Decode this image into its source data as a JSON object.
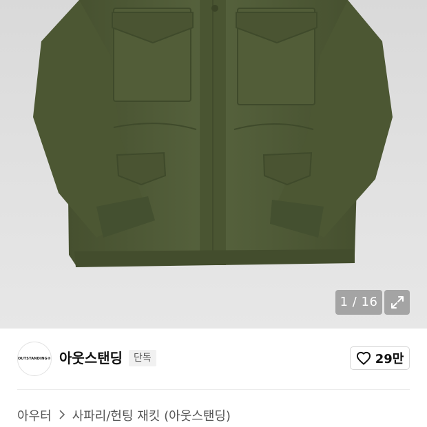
{
  "gallery": {
    "counter": "1 / 16",
    "current_index": 1,
    "total": 16,
    "expand_icon": "expand-icon",
    "background_color": "#dedede",
    "jacket_color": "#4f5a38"
  },
  "brand": {
    "logo_text": "OUTSTANDING®",
    "name": "아웃스탠딩",
    "badge": "단독"
  },
  "like": {
    "icon": "heart-outline-icon",
    "count": "29만"
  },
  "breadcrumb": {
    "category": "아우터",
    "separator_icon": "chevron-right-icon",
    "subcategory": "사파리/헌팅 재킷 (아웃스탠딩)"
  }
}
